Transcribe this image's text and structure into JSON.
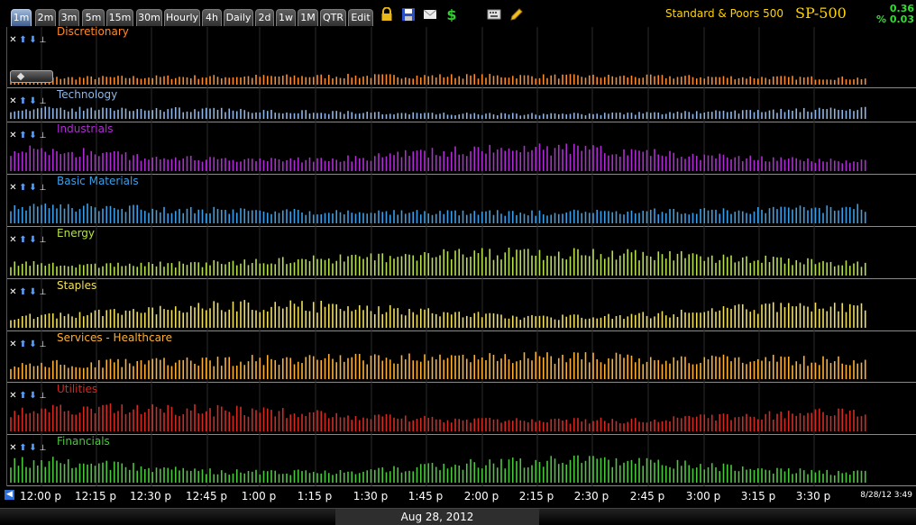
{
  "toolbar": {
    "tabs": [
      "1m",
      "2m",
      "3m",
      "5m",
      "15m",
      "30m",
      "Hourly",
      "4h",
      "Daily",
      "2d",
      "1w",
      "1M",
      "QTR",
      "Edit"
    ],
    "active_tab": "1m",
    "icons": [
      "lock-icon",
      "save-icon",
      "email-icon",
      "dollar-icon",
      "keyboard-icon",
      "pencil-icon"
    ]
  },
  "header": {
    "index_name": "Standard & Poors 500",
    "symbol": "SP-500",
    "change_value": "0.36",
    "change_percent": "% 0.03"
  },
  "colors": {
    "tab_active": "#4a6fa5",
    "header_text": "#ffd400",
    "change_text": "#33dd33",
    "panel_divider": "#8a8a8a"
  },
  "panel_controls": {
    "close": "✕",
    "up": "⬆",
    "down": "⬇",
    "pin": "⊥"
  },
  "panels": [
    {
      "title": "Discretionary",
      "color": "#ff8a2a"
    },
    {
      "title": "Technology",
      "color": "#8fb6e6"
    },
    {
      "title": "Industrials",
      "color": "#b02cd4"
    },
    {
      "title": "Basic Materials",
      "color": "#3a9fe8"
    },
    {
      "title": "Energy",
      "color": "#b7e04a"
    },
    {
      "title": "Staples",
      "color": "#f2e05a"
    },
    {
      "title": "Services - Healthcare",
      "color": "#ffb030"
    },
    {
      "title": "Utilities",
      "color": "#d42a22"
    },
    {
      "title": "Financials",
      "color": "#48c83a"
    }
  ],
  "time_axis": {
    "ticks": [
      "12:00 p",
      "12:15 p",
      "12:30 p",
      "12:45 p",
      "1:00 p",
      "1:15 p",
      "1:30 p",
      "1:45 p",
      "2:00 p",
      "2:15 p",
      "2:30 p",
      "2:45 p",
      "3:00 p",
      "3:15 p",
      "3:30 p"
    ],
    "timestamp": "8/28/12 3:49",
    "date": "Aug 28, 2012"
  }
}
